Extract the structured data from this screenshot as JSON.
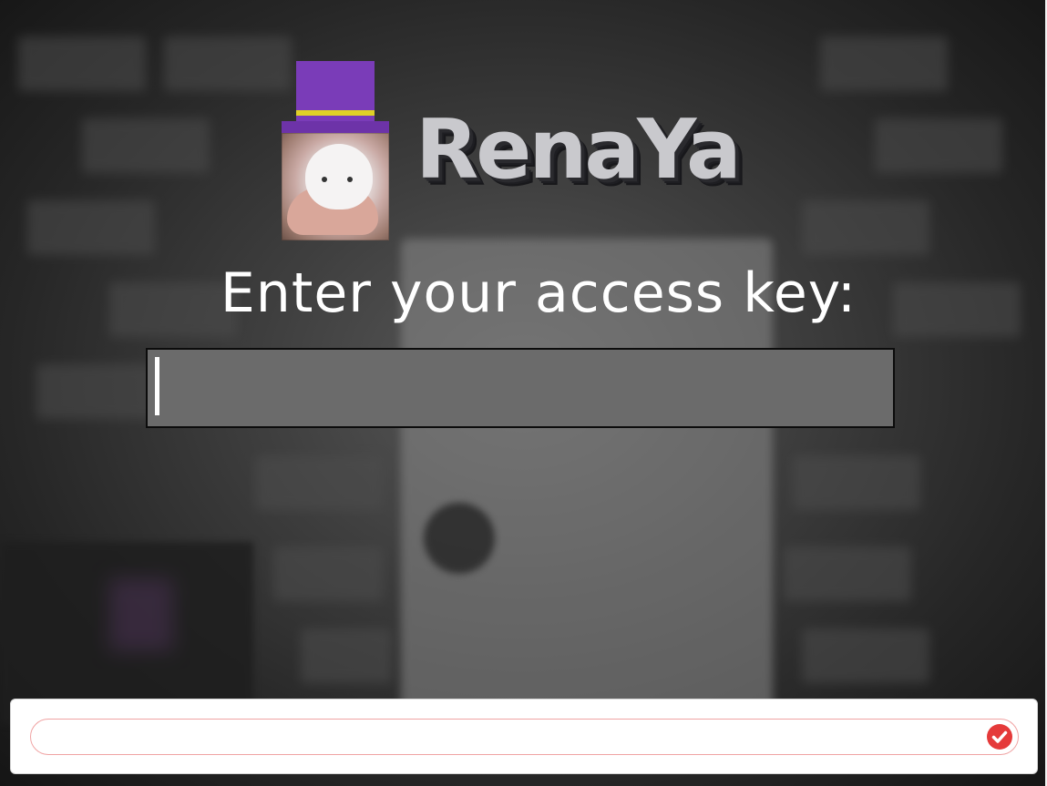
{
  "logo": {
    "title": "RenaYa",
    "hat_color": "#7a3cb8",
    "band_color": "#e0d126",
    "avatar_icon": "hamster-avatar-icon"
  },
  "prompt": {
    "label": "Enter your access key:"
  },
  "access_key": {
    "value": "",
    "placeholder": ""
  },
  "bottom_bar": {
    "value": "",
    "placeholder": "",
    "status_icon": "check-circle-icon",
    "accent": "#e53a3a"
  }
}
